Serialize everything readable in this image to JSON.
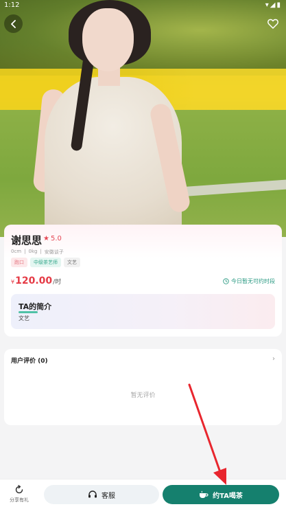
{
  "status_bar": {
    "time": "1:12",
    "icons": "▾◢▮"
  },
  "nav": {
    "back_icon": "chevron-left-icon",
    "favorite_icon": "heart-outline-icon"
  },
  "profile": {
    "name": "谢思思",
    "rating": "5.0",
    "height": "0cm",
    "weight": "0kg",
    "location": "安徽谈子",
    "tags": [
      "跑口",
      "中级茶艺师",
      "文艺"
    ],
    "price_symbol": "¥",
    "price_value": "120.00",
    "price_unit": "/时",
    "availability": "今日暂无可约时段",
    "intro_title": "TA的简介",
    "intro_text": "文艺"
  },
  "reviews": {
    "title": "用户评价 (0)",
    "arrow": "›",
    "empty_text": "暂无评价"
  },
  "bottom_bar": {
    "share_label": "分享有礼",
    "service_label": "客服",
    "book_label": "约TA喝茶"
  },
  "colors": {
    "accent": "#15806e",
    "price": "#e53b46",
    "annotation_arrow": "#e8262e"
  }
}
